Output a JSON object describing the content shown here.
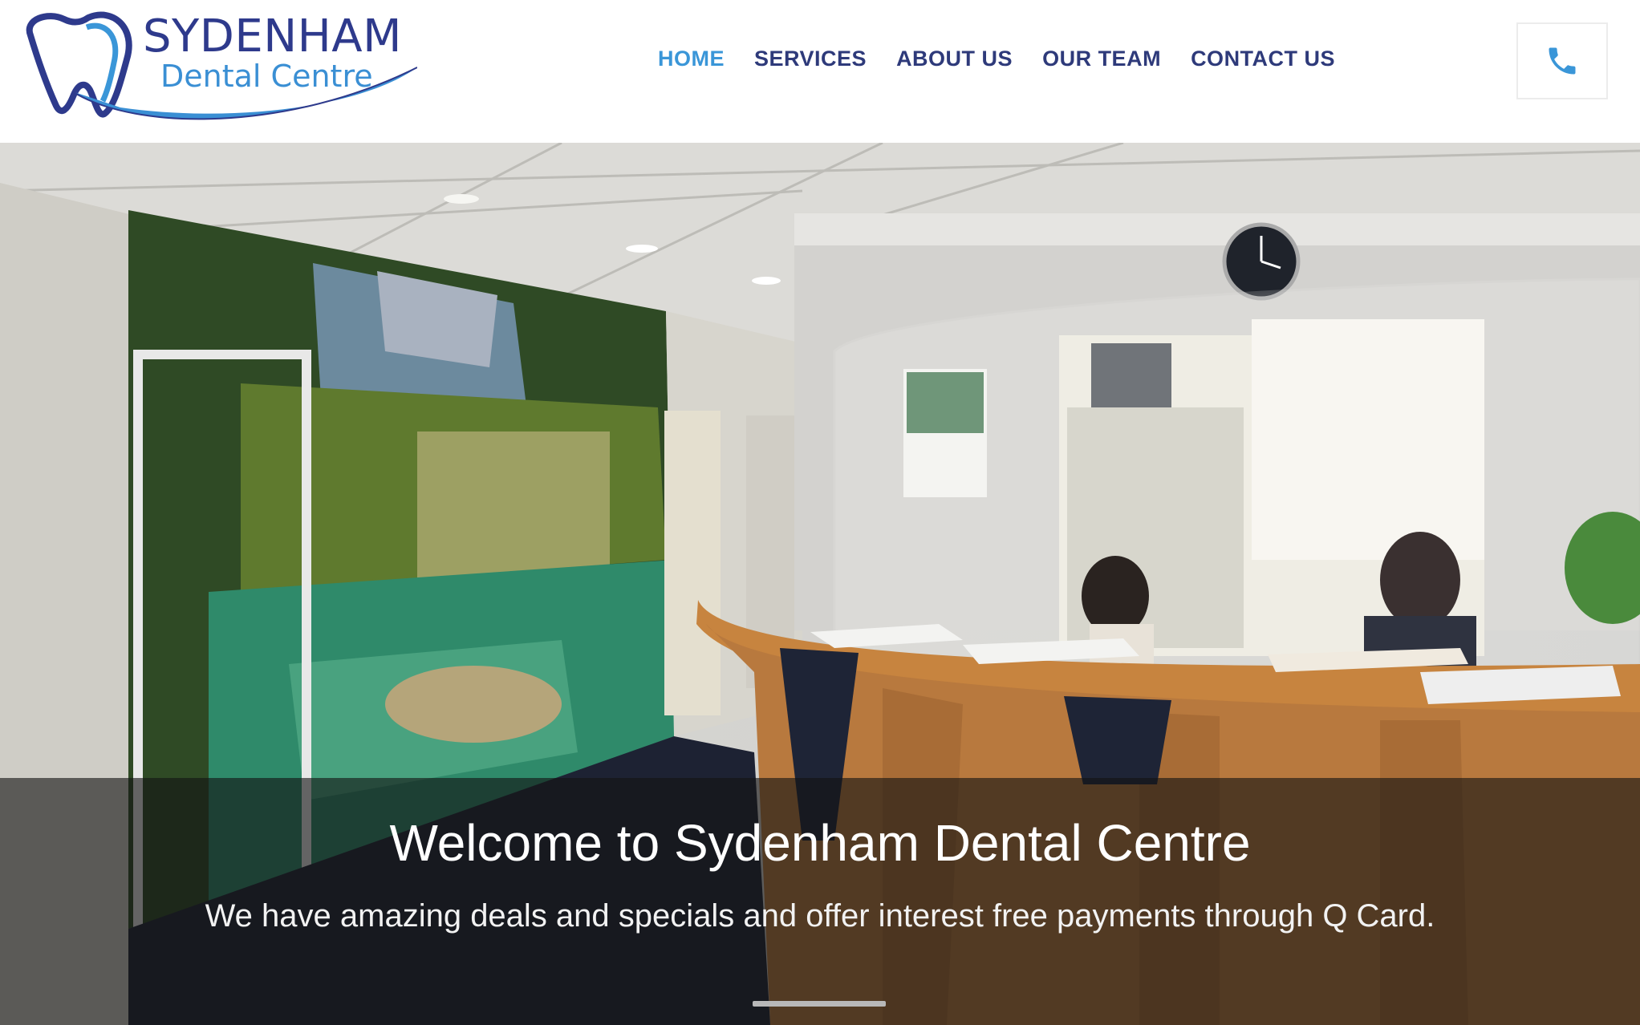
{
  "brand": {
    "name": "SYDENHAM",
    "subtitle": "Dental Centre",
    "primary_color": "#2e3a8c",
    "accent_color": "#3a96d8"
  },
  "nav": {
    "items": [
      {
        "label": "HOME",
        "active": true
      },
      {
        "label": "SERVICES",
        "active": false
      },
      {
        "label": "ABOUT US",
        "active": false
      },
      {
        "label": "OUR TEAM",
        "active": false
      },
      {
        "label": "CONTACT US",
        "active": false
      }
    ]
  },
  "header": {
    "phone_icon": "phone-icon"
  },
  "hero": {
    "title": "Welcome to Sydenham Dental Centre",
    "text": "We have amazing deals and specials and offer interest free payments through Q Card.",
    "image": "reception-desk-photo"
  }
}
